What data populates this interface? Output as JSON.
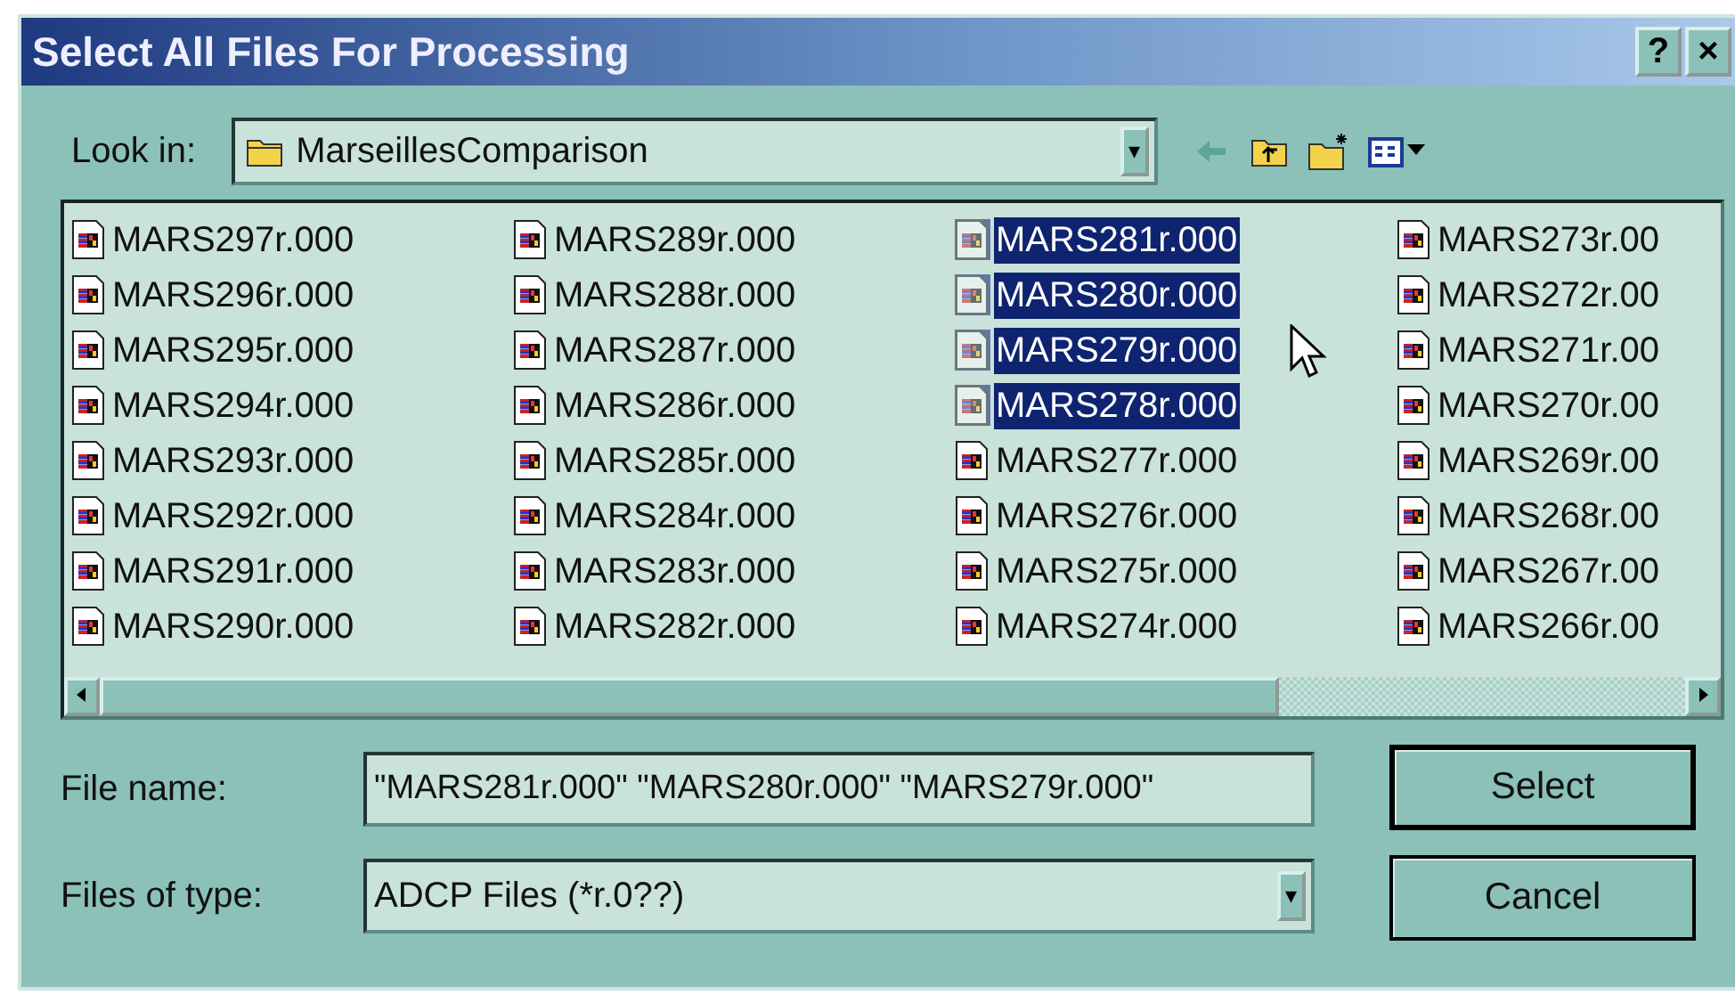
{
  "window": {
    "title": "Select All Files For Processing",
    "title_buttons": [
      "?",
      "×"
    ]
  },
  "look_in": {
    "label": "Look in:",
    "value": "MarseillesComparison",
    "dropdown": "▾"
  },
  "toolbar": [
    {
      "kind": "back",
      "disabled": true
    },
    {
      "kind": "up"
    },
    {
      "kind": "newfolder"
    },
    {
      "kind": "view"
    }
  ],
  "files": [
    {
      "name": "MARS297r.000",
      "selected": false
    },
    {
      "name": "MARS296r.000",
      "selected": false
    },
    {
      "name": "MARS295r.000",
      "selected": false
    },
    {
      "name": "MARS294r.000",
      "selected": false
    },
    {
      "name": "MARS293r.000",
      "selected": false
    },
    {
      "name": "MARS292r.000",
      "selected": false
    },
    {
      "name": "MARS291r.000",
      "selected": false
    },
    {
      "name": "MARS290r.000",
      "selected": false
    },
    {
      "name": "MARS289r.000",
      "selected": false
    },
    {
      "name": "MARS288r.000",
      "selected": false
    },
    {
      "name": "MARS287r.000",
      "selected": false
    },
    {
      "name": "MARS286r.000",
      "selected": false
    },
    {
      "name": "MARS285r.000",
      "selected": false
    },
    {
      "name": "MARS284r.000",
      "selected": false
    },
    {
      "name": "MARS283r.000",
      "selected": false
    },
    {
      "name": "MARS282r.000",
      "selected": false
    },
    {
      "name": "MARS281r.000",
      "selected": true
    },
    {
      "name": "MARS280r.000",
      "selected": true
    },
    {
      "name": "MARS279r.000",
      "selected": true
    },
    {
      "name": "MARS278r.000",
      "selected": true
    },
    {
      "name": "MARS277r.000",
      "selected": false
    },
    {
      "name": "MARS276r.000",
      "selected": false
    },
    {
      "name": "MARS275r.000",
      "selected": false
    },
    {
      "name": "MARS274r.000",
      "selected": false
    },
    {
      "name": "MARS273r.00",
      "selected": false
    },
    {
      "name": "MARS272r.00",
      "selected": false
    },
    {
      "name": "MARS271r.00",
      "selected": false
    },
    {
      "name": "MARS270r.00",
      "selected": false
    },
    {
      "name": "MARS269r.00",
      "selected": false
    },
    {
      "name": "MARS268r.00",
      "selected": false
    },
    {
      "name": "MARS267r.00",
      "selected": false
    },
    {
      "name": "MARS266r.00",
      "selected": false
    }
  ],
  "file_name": {
    "label": "File name:",
    "value": "\"MARS281r.000\" \"MARS280r.000\" \"MARS279r.000\""
  },
  "file_type": {
    "label": "Files of type:",
    "value": "ADCP Files (*r.0??)",
    "dropdown": "▾"
  },
  "buttons": [
    {
      "label": "Select",
      "default": true
    },
    {
      "label": "Cancel",
      "default": false
    }
  ]
}
